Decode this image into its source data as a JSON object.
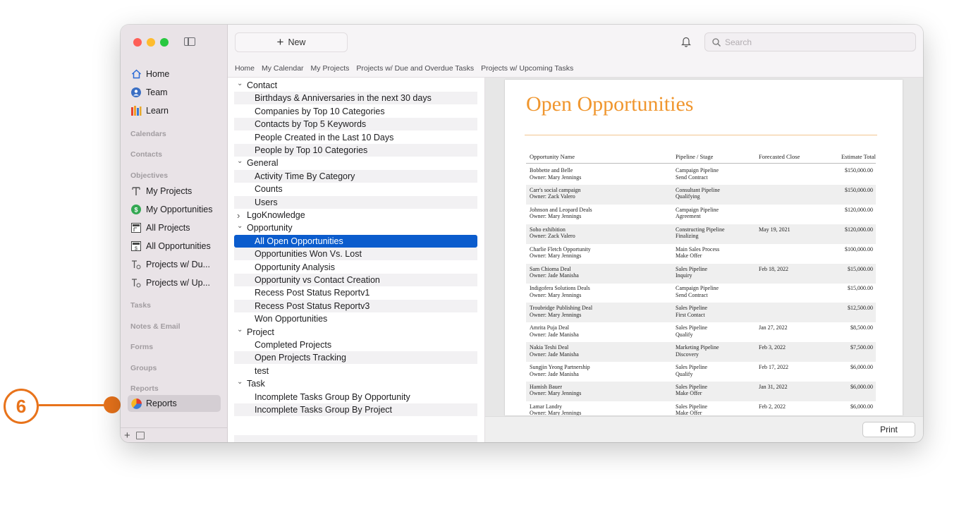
{
  "callout": {
    "number": "6",
    "color": "#e8731b"
  },
  "sidebar": {
    "top_items": [
      {
        "label": "Home",
        "icon": "house-icon"
      },
      {
        "label": "Team",
        "icon": "team-icon"
      },
      {
        "label": "Learn",
        "icon": "books-icon"
      }
    ],
    "sections": {
      "calendars": "Calendars",
      "contacts": "Contacts",
      "objectives": "Objectives",
      "tasks": "Tasks",
      "notes_email": "Notes & Email",
      "forms": "Forms",
      "groups": "Groups",
      "reports": "Reports"
    },
    "objective_items": [
      {
        "label": "My Projects",
        "icon": "project-icon"
      },
      {
        "label": "My Opportunities",
        "icon": "dollar-icon"
      },
      {
        "label": "All Projects",
        "icon": "project-list-icon"
      },
      {
        "label": "All Opportunities",
        "icon": "opportunity-list-icon"
      },
      {
        "label": "Projects w/ Du...",
        "icon": "project-tasks-icon"
      },
      {
        "label": "Projects w/ Up...",
        "icon": "project-tasks-icon"
      }
    ],
    "reports_item": {
      "label": "Reports",
      "icon": "pie-chart-icon",
      "selected": true
    }
  },
  "toolbar": {
    "new_label": "New",
    "search_placeholder": "Search"
  },
  "tabs": [
    "Home",
    "My Calendar",
    "My Projects",
    "Projects w/ Due and Overdue Tasks",
    "Projects w/ Upcoming Tasks"
  ],
  "report_list": [
    {
      "label": "Contact",
      "type": "group",
      "expanded": true
    },
    {
      "label": "Birthdays & Anniversaries in the next 30 days",
      "type": "child"
    },
    {
      "label": "Companies by Top 10 Categories",
      "type": "child"
    },
    {
      "label": "Contacts by Top 5 Keywords",
      "type": "child"
    },
    {
      "label": "People Created in the Last 10 Days",
      "type": "child"
    },
    {
      "label": "People by Top 10 Categories",
      "type": "child"
    },
    {
      "label": "General",
      "type": "group",
      "expanded": true
    },
    {
      "label": "Activity Time By Category",
      "type": "child"
    },
    {
      "label": "Counts",
      "type": "child"
    },
    {
      "label": "Users",
      "type": "child"
    },
    {
      "label": "LgoKnowledge",
      "type": "group",
      "expanded": false
    },
    {
      "label": "Opportunity",
      "type": "group",
      "expanded": true
    },
    {
      "label": "All Open Opportunities",
      "type": "child",
      "selected": true
    },
    {
      "label": "Opportunities Won Vs. Lost",
      "type": "child"
    },
    {
      "label": "Opportunity Analysis",
      "type": "child"
    },
    {
      "label": "Opportunity vs Contact Creation",
      "type": "child"
    },
    {
      "label": "Recess Post Status Reportv1",
      "type": "child"
    },
    {
      "label": "Recess Post Status Reportv3",
      "type": "child"
    },
    {
      "label": "Won Opportunities",
      "type": "child"
    },
    {
      "label": "Project",
      "type": "group",
      "expanded": true
    },
    {
      "label": "Completed Projects",
      "type": "child"
    },
    {
      "label": "Open Projects Tracking",
      "type": "child"
    },
    {
      "label": "test",
      "type": "child"
    },
    {
      "label": "Task",
      "type": "group",
      "expanded": true
    },
    {
      "label": "Incomplete Tasks Group By Opportunity",
      "type": "child"
    },
    {
      "label": "Incomplete Tasks Group By Project",
      "type": "child"
    }
  ],
  "report": {
    "title": "Open Opportunities",
    "title_color": "#f0962e",
    "columns": [
      "Opportunity Name",
      "Pipeline / Stage",
      "Forecasted Close",
      "Estimate Total"
    ],
    "rows": [
      {
        "name": "Bobbette and Belle",
        "owner": "Owner: Mary Jennings",
        "pipeline": "Campaign Pipeline",
        "stage": "Send Contract",
        "close": "",
        "total": "$150,000.00"
      },
      {
        "name": "Carr's social campaign",
        "owner": "Owner: Zack Valero",
        "pipeline": "Consultant Pipeline",
        "stage": "Qualifying",
        "close": "",
        "total": "$150,000.00"
      },
      {
        "name": "Johnson and Leopard Deals",
        "owner": "Owner: Mary Jennings",
        "pipeline": "Campaign Pipeline",
        "stage": "Agreement",
        "close": "",
        "total": "$120,000.00"
      },
      {
        "name": "Soho exhibition",
        "owner": "Owner: Zack Valero",
        "pipeline": "Constructing Pipeline",
        "stage": "Finalizing",
        "close": "May 19, 2021",
        "total": "$120,000.00"
      },
      {
        "name": "Charlie Fletch Opportunity",
        "owner": "Owner: Mary Jennings",
        "pipeline": "Main Sales Process",
        "stage": "Make Offer",
        "close": "",
        "total": "$100,000.00"
      },
      {
        "name": "Sam Chioma Deal",
        "owner": "Owner: Jade Manisha",
        "pipeline": "Sales Pipeline",
        "stage": "Inquiry",
        "close": "Feb 18, 2022",
        "total": "$15,000.00"
      },
      {
        "name": "Indigofera Solutions Deals",
        "owner": "Owner: Mary Jennings",
        "pipeline": "Campaign Pipeline",
        "stage": "Send Contract",
        "close": "",
        "total": "$15,000.00"
      },
      {
        "name": "Troubridge Publishing Deal",
        "owner": "Owner: Mary Jennings",
        "pipeline": "Sales Pipeline",
        "stage": "First Contact",
        "close": "",
        "total": "$12,500.00"
      },
      {
        "name": "Amrita Puja Deal",
        "owner": "Owner: Jade Manisha",
        "pipeline": "Sales Pipeline",
        "stage": "Qualify",
        "close": "Jan 27, 2022",
        "total": "$8,500.00"
      },
      {
        "name": "Nakia Teshi Deal",
        "owner": "Owner: Jade Manisha",
        "pipeline": "Marketing Pipeline",
        "stage": "Discovery",
        "close": "Feb 3, 2022",
        "total": "$7,500.00"
      },
      {
        "name": "Sungjin Yeong Partnership",
        "owner": "Owner: Jade Manisha",
        "pipeline": "Sales Pipeline",
        "stage": "Qualify",
        "close": "Feb 17, 2022",
        "total": "$6,000.00"
      },
      {
        "name": "Hamish Bauer",
        "owner": "Owner: Mary Jennings",
        "pipeline": "Sales Pipeline",
        "stage": "Make Offer",
        "close": "Jan 31, 2022",
        "total": "$6,000.00"
      },
      {
        "name": "Lamar Landry",
        "owner": "Owner: Mary Jennings",
        "pipeline": "Sales Pipeline",
        "stage": "Make Offer",
        "close": "Feb 2, 2022",
        "total": "$6,000.00"
      }
    ]
  },
  "print_label": "Print",
  "accent_color": "#0b5ccd"
}
